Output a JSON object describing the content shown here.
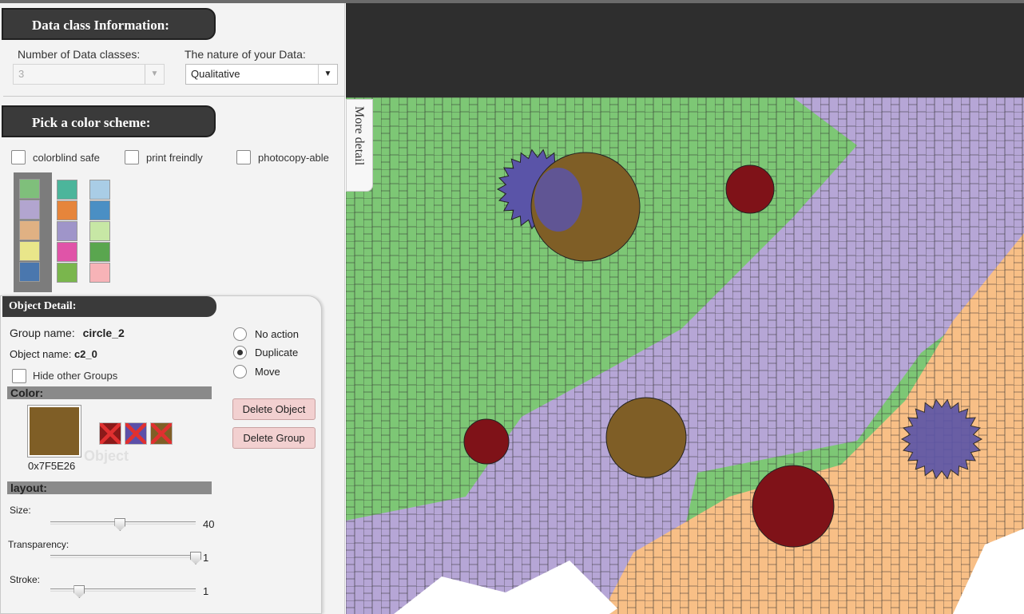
{
  "data_class": {
    "header": "Data class Information:",
    "num_classes_label": "Number of Data classes:",
    "num_classes_value": "3",
    "nature_label": "The nature of your Data:",
    "nature_value": "Qualitative"
  },
  "color_scheme": {
    "header": "Pick a color scheme:",
    "filters": [
      "colorblind safe",
      "print freindly",
      "photocopy-able"
    ],
    "schemes": [
      [
        "#7fbf7b",
        "#b2a5cf",
        "#e0b183",
        "#e9e68a",
        "#4a77ae"
      ],
      [
        "#4cb59b",
        "#e6853b",
        "#9f95c9",
        "#e054a8",
        "#7ab64d"
      ],
      [
        "#a9cde6",
        "#4a8fc4",
        "#c7e7a5",
        "#5aa64f",
        "#f7b3b7"
      ]
    ]
  },
  "object_detail": {
    "header": "Object Detail:",
    "group_name_label": "Group name:",
    "group_name_value": "circle_2",
    "object_name_label": "Object name:",
    "object_name_value": "c2_0",
    "hide_groups_label": "Hide other Groups",
    "color_section": "Color:",
    "color_hex": "0x7F5E26",
    "color_value": "#7f5e26",
    "alt_swatches": [
      "#8b1a1a",
      "#5b4fa8",
      "#7f5e26"
    ],
    "actions": [
      "No action",
      "Duplicate",
      "Move"
    ],
    "selected_action": "Duplicate",
    "delete_object": "Delete Object",
    "delete_group": "Delete Group",
    "layout_section": "layout:",
    "size_label": "Size:",
    "size_value": "40",
    "size_level": 0.48,
    "transparency_label": "Transparency:",
    "transparency_value": "1",
    "transparency_level": 1.0,
    "stroke_label": "Stroke:",
    "stroke_value": "1",
    "stroke_level": 0.2,
    "ghost_text": "Object"
  },
  "map": {
    "more_detail": "More detail",
    "region_colors": {
      "green": "#7dc775",
      "purple": "#b6a6d6",
      "orange": "#f8bf86",
      "dark_red": "#7f1218",
      "brown": "#7f5e26",
      "blue": "#5a54a8"
    }
  }
}
